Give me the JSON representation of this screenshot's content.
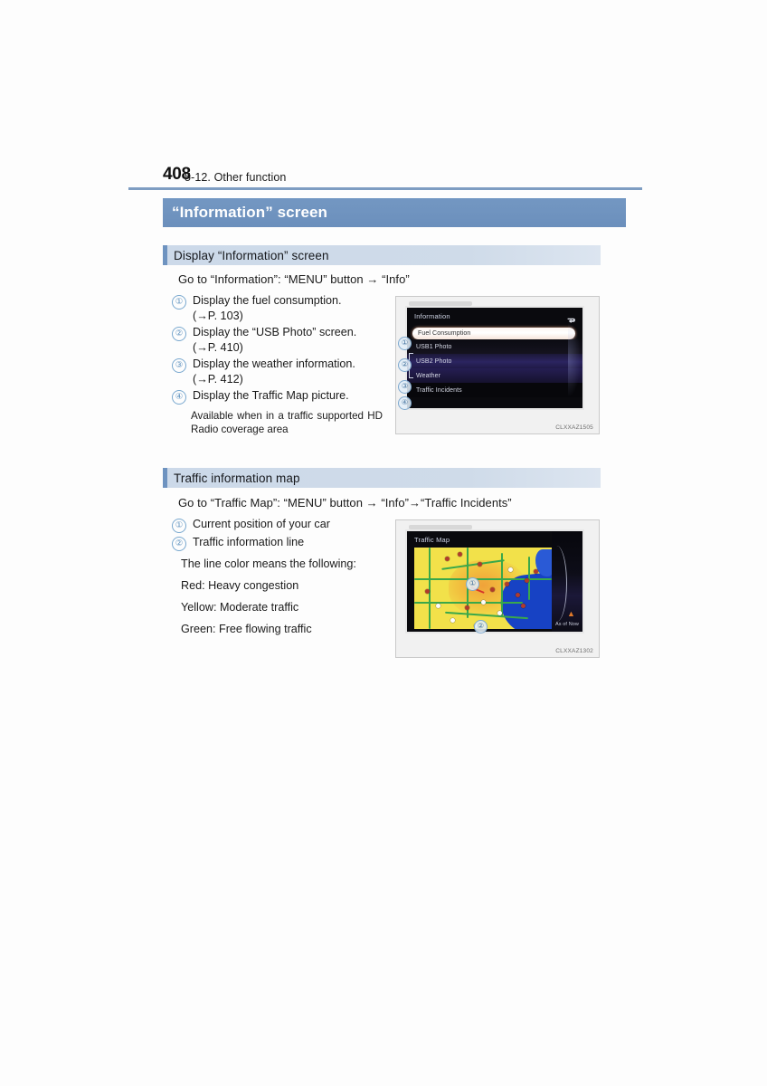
{
  "header": {
    "page_number": "408",
    "section_title": "5-12. Other function"
  },
  "section": {
    "title": "“Information” screen"
  },
  "subsections": [
    {
      "id": "display-information-screen",
      "title": "Display “Information” screen",
      "goto": "Go to “Information”: “MENU” button → “Info”",
      "items": [
        {
          "num": "①",
          "text": "Display the fuel consumption.",
          "ref": "(→P. 103)"
        },
        {
          "num": "②",
          "text": "Display the “USB Photo” screen.",
          "ref": "(→P. 410)"
        },
        {
          "num": "③",
          "text": "Display the weather information.",
          "ref": "(→P. 412)"
        },
        {
          "num": "④",
          "text": "Display the Traffic Map picture.",
          "ref": ""
        }
      ],
      "note": "Available when in a traffic supported HD Radio coverage area"
    },
    {
      "id": "traffic-information-map",
      "title": "Traffic information map",
      "goto": "Go to “Traffic Map”: “MENU” button → “Info”→“Traffic Incidents”",
      "items": [
        {
          "num": "①",
          "text": "Current position of your car"
        },
        {
          "num": "②",
          "text": "Traffic information line"
        }
      ],
      "legend_intro": "The line color means the following:",
      "legend": [
        "Red: Heavy congestion",
        "Yellow: Moderate traffic",
        "Green: Free flowing traffic"
      ]
    }
  ],
  "figures": [
    {
      "id": "information-screen-figure",
      "screen_title": "Information",
      "back_icon": "back-arrow-icon",
      "code": "CLXXAZ1505",
      "menu_items": [
        {
          "label": "Fuel Consumption",
          "callout": "①",
          "state": "selected"
        },
        {
          "label": "USB1 Photo",
          "callout": "②",
          "state": "normal"
        },
        {
          "label": "USB2 Photo",
          "callout": "",
          "state": "normal"
        },
        {
          "label": "Weather",
          "callout": "③",
          "state": "normal"
        },
        {
          "label": "Traffic Incidents",
          "callout": "④",
          "state": "normal"
        }
      ]
    },
    {
      "id": "traffic-map-figure",
      "screen_title": "Traffic Map",
      "back_icon": "back-arrow-icon",
      "code": "CLXXAZ1302",
      "status_label": "As of Now",
      "callouts": [
        {
          "num": "①",
          "meaning": "current position of your car"
        },
        {
          "num": "②",
          "meaning": "traffic information line"
        }
      ]
    }
  ],
  "colors": {
    "section_bar": "#6f93bf",
    "subsection_bar": "#ccd9e9",
    "accent_rule": "#7e9dc2",
    "callout_blue": "#5f92bf"
  }
}
